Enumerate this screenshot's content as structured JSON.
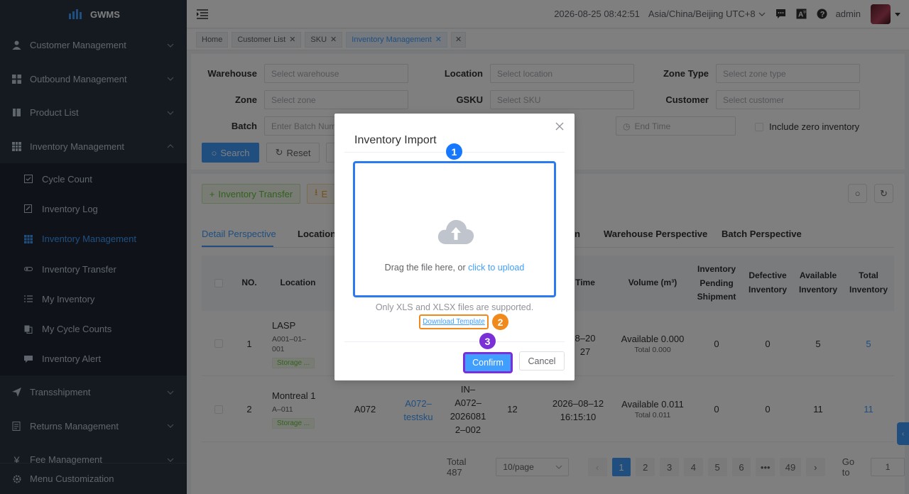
{
  "app": {
    "name": "GWMS"
  },
  "sidebar": {
    "items": [
      {
        "label": "Customer Management",
        "icon": "user-icon"
      },
      {
        "label": "Outbound Management",
        "icon": "grid-icon"
      },
      {
        "label": "Product List",
        "icon": "book-icon"
      },
      {
        "label": "Inventory Management",
        "icon": "table-icon",
        "expanded": true
      }
    ],
    "subitems": [
      {
        "label": "Cycle Count",
        "icon": "checkbox-icon"
      },
      {
        "label": "Inventory Log",
        "icon": "edit-icon"
      },
      {
        "label": "Inventory Management",
        "icon": "table-icon",
        "active": true
      },
      {
        "label": "Inventory Transfer",
        "icon": "toggle-icon"
      },
      {
        "label": "My Inventory",
        "icon": "list-icon"
      },
      {
        "label": "My Cycle Counts",
        "icon": "copy-icon"
      },
      {
        "label": "Inventory Alert",
        "icon": "chat-icon"
      }
    ],
    "more_items": [
      {
        "label": "Transshipment",
        "icon": "send-icon"
      },
      {
        "label": "Returns Management",
        "icon": "doc-icon"
      },
      {
        "label": "Fee Management",
        "icon": "yen-icon"
      }
    ],
    "bottom": {
      "label": "Menu Customization",
      "icon": "gear-icon"
    }
  },
  "header": {
    "datetime": "2026-08-25 08:42:51",
    "timezone": "Asia/China/Beijing UTC+8",
    "user": "admin"
  },
  "tags": [
    {
      "label": "Home",
      "closable": false
    },
    {
      "label": "Customer List",
      "closable": true
    },
    {
      "label": "SKU",
      "closable": true
    },
    {
      "label": "Inventory Management",
      "closable": true,
      "active": true
    }
  ],
  "filters": {
    "warehouse": {
      "label": "Warehouse",
      "placeholder": "Select warehouse"
    },
    "location": {
      "label": "Location",
      "placeholder": "Select location"
    },
    "zone_type": {
      "label": "Zone Type",
      "placeholder": "Select zone type"
    },
    "zone": {
      "label": "Zone",
      "placeholder": "Select zone"
    },
    "gsku": {
      "label": "GSKU",
      "placeholder": "Select SKU"
    },
    "customer": {
      "label": "Customer",
      "placeholder": "Select customer"
    },
    "batch": {
      "label": "Batch",
      "placeholder": "Enter Batch Num"
    },
    "end_time": {
      "placeholder": "End Time"
    },
    "zero_inventory": {
      "label": "Include zero inventory"
    },
    "search_label": "Search",
    "reset_label": "Reset"
  },
  "toolbar": {
    "transfer_label": "Inventory Transfer",
    "export_label": "E"
  },
  "tabs": [
    "Detail Perspective",
    "Location",
    "n",
    "Warehouse Perspective",
    "Batch Perspective"
  ],
  "table": {
    "headers": {
      "no": "NO.",
      "location": "Location",
      "time": "Time",
      "volume": "Volume (m³)",
      "pending": [
        "Inventory",
        "Pending",
        "Shipment"
      ],
      "defective": [
        "Defective",
        "Inventory"
      ],
      "available": [
        "Available",
        "Inventory"
      ],
      "total": [
        "Total",
        "Inventory"
      ]
    },
    "rows": [
      {
        "no": "1",
        "location_name": "LASP",
        "location_code": [
          "A001–01–",
          "001"
        ],
        "badge": "Storage ...",
        "time": [
          "8–20",
          "27"
        ],
        "volume_available": "Available 0.000",
        "volume_total": "Total 0.000",
        "pending": "0",
        "defective": "0",
        "available": "5",
        "total": "5"
      },
      {
        "no": "2",
        "location_name": "Montreal 1",
        "location_code": [
          "A–011"
        ],
        "badge": "Storage ...",
        "warehouse": "A072",
        "sku": [
          "A072–",
          "testsku"
        ],
        "batch": [
          "IN–",
          "A072–",
          "2026081",
          "2–002"
        ],
        "qty": "12",
        "time": [
          "2026–08–12",
          "16:15:10"
        ],
        "volume_available": "Available 0.011",
        "volume_total": "Total 0.011",
        "pending": "0",
        "defective": "0",
        "available": "11",
        "total": "11"
      }
    ]
  },
  "pagination": {
    "total": "Total 487",
    "page_size": "10/page",
    "pages": [
      "1",
      "2",
      "3",
      "4",
      "5",
      "6",
      "•••",
      "49"
    ],
    "goto_label": "Go to",
    "goto_value": "1"
  },
  "modal": {
    "title": "Inventory Import",
    "drop_text": "Drag the file here, or ",
    "upload_link": "click to upload",
    "tip": "Only XLS and XLSX files are supported.",
    "download_template": "Download Template",
    "confirm": "Confirm",
    "cancel": "Cancel"
  },
  "markers": [
    "1",
    "2",
    "3"
  ],
  "colors": {
    "accent": "#409eff",
    "marker1": "#1677ff",
    "marker2": "#f08a1c",
    "marker3": "#7b2fd6"
  }
}
